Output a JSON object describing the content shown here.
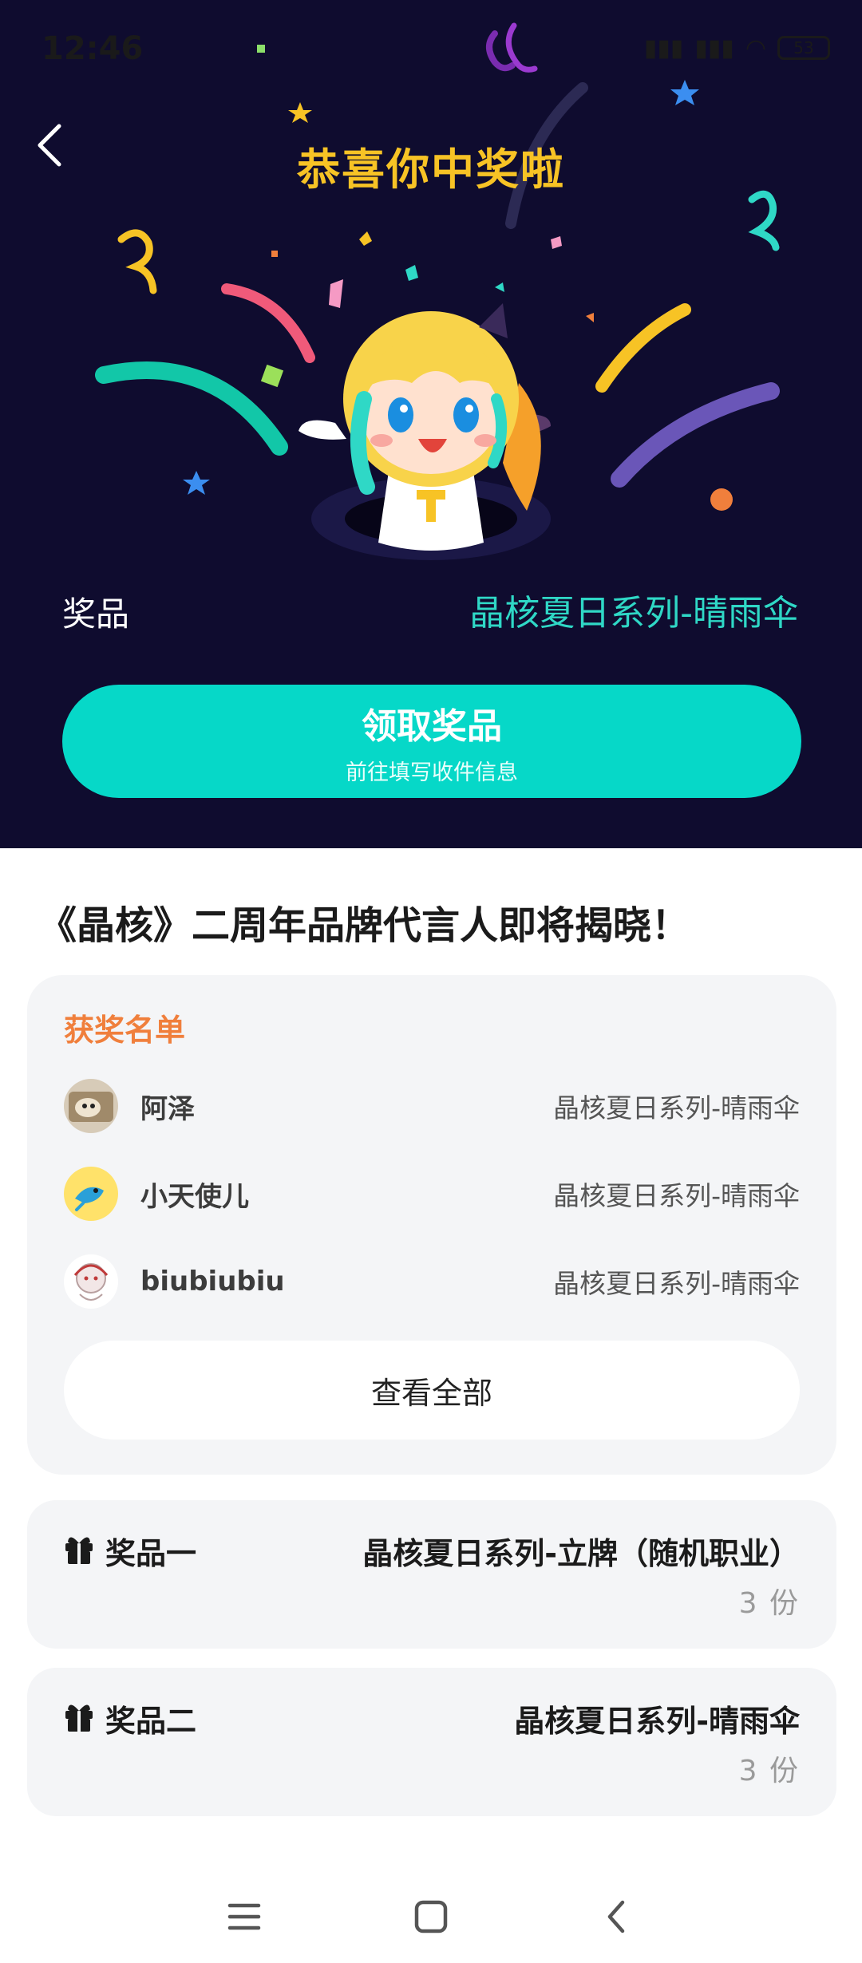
{
  "status_bar": {
    "time": "12:46",
    "battery": "53"
  },
  "hero": {
    "title": "恭喜你中奖啦",
    "prize_label": "奖品",
    "prize_value": "晶核夏日系列-晴雨伞",
    "claim_button": {
      "label": "领取奖品",
      "sublabel": "前往填写收件信息"
    }
  },
  "headline": "《晶核》二周年品牌代言人即将揭晓！",
  "winners": {
    "title": "获奖名单",
    "items": [
      {
        "name": "阿泽",
        "prize": "晶核夏日系列-晴雨伞"
      },
      {
        "name": "小天使儿",
        "prize": "晶核夏日系列-晴雨伞"
      },
      {
        "name": "biubiubiu",
        "prize": "晶核夏日系列-晴雨伞"
      }
    ],
    "view_all": "查看全部"
  },
  "prizes": [
    {
      "label": "奖品一",
      "name": "晶核夏日系列-立牌（随机职业）",
      "count": "3 份"
    },
    {
      "label": "奖品二",
      "name": "晶核夏日系列-晴雨伞",
      "count": "3 份"
    }
  ],
  "colors": {
    "hero_bg": "#0f0c2f",
    "title_yellow": "#f7c325",
    "accent_teal": "#06d8c8",
    "winners_orange": "#f07f3c"
  }
}
